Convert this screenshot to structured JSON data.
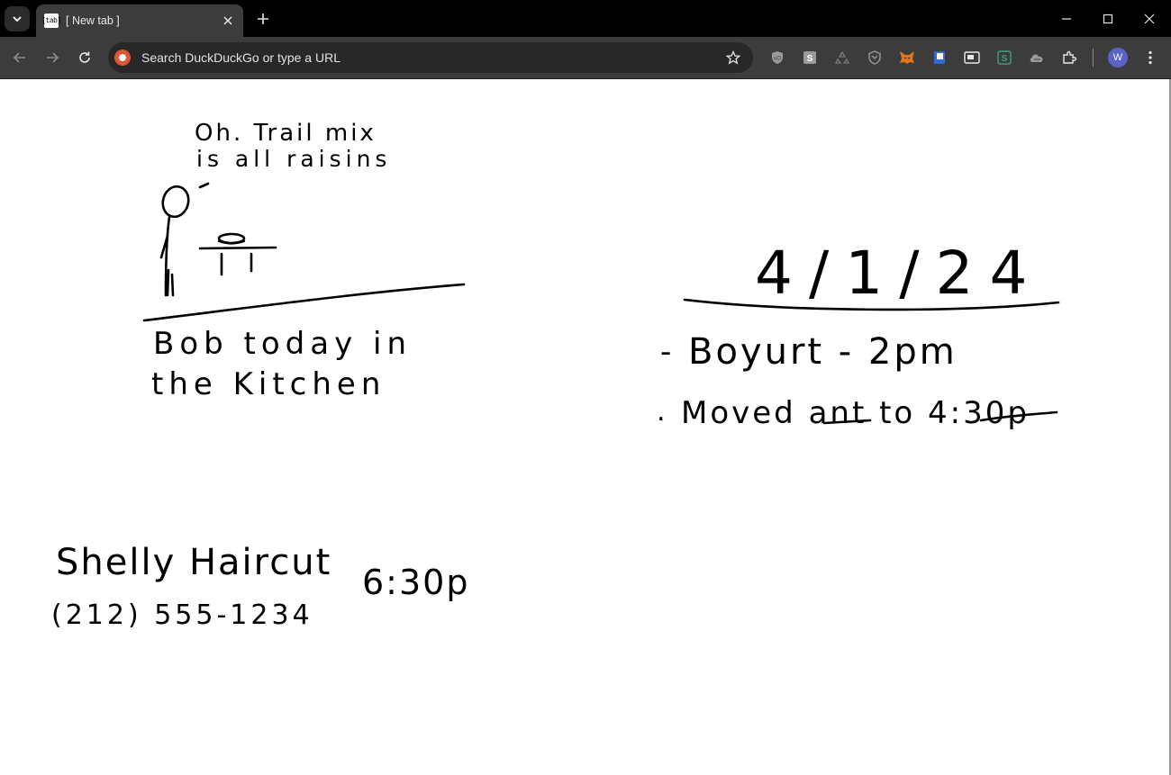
{
  "browser": {
    "tab": {
      "title": "[ New tab ]",
      "favicon_text": "[tab]"
    },
    "omnibox": {
      "placeholder": "Search DuckDuckGo or type a URL",
      "value": ""
    },
    "profile_initial": "W",
    "extensions": [
      "ublock-icon",
      "s-extension-icon",
      "recycle-icon",
      "shield-extension-icon",
      "metamask-fox-icon",
      "book-icon",
      "picture-in-picture-icon",
      "s-green-extension-icon",
      "cloud-extension-icon",
      "puzzle-icon"
    ],
    "accent_color": "#5a63c6"
  },
  "whiteboard": {
    "speech": [
      "Oh. Trail mix",
      "is all raisins"
    ],
    "caption": [
      "Bob today in",
      "the Kitchen"
    ],
    "date": "4/1/24",
    "notes": [
      {
        "bullet": "-",
        "text": "Boyurt - 2pm"
      },
      {
        "bullet": ".",
        "text": "Moved ant to 4:30p"
      }
    ],
    "appointment": {
      "title": "Shelly Haircut",
      "time": "6:30p",
      "phone": "(212) 555-1234"
    }
  }
}
